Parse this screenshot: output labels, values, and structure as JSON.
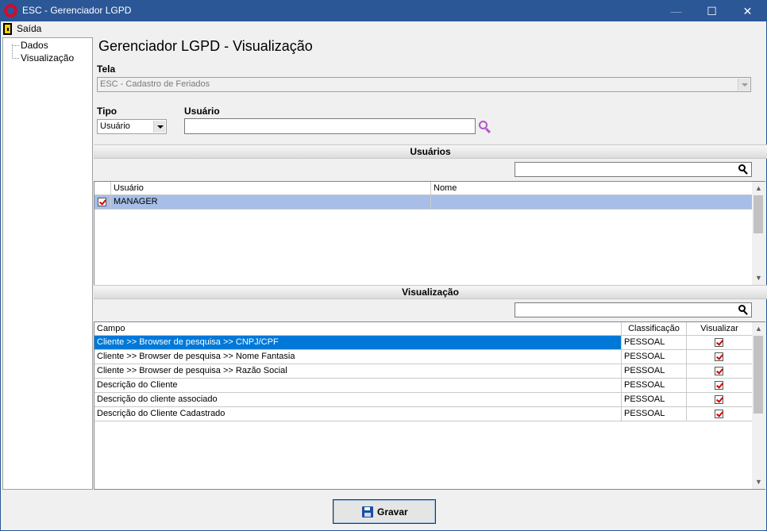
{
  "window": {
    "title": "ESC - Gerenciador LGPD",
    "minimize": "—",
    "maximize": "☐",
    "close": "✕"
  },
  "menu": {
    "saida": "Saída"
  },
  "nav": {
    "items": [
      {
        "label": "Dados"
      },
      {
        "label": "Visualização"
      }
    ]
  },
  "heading": "Gerenciador LGPD - Visualização",
  "tela": {
    "label": "Tela",
    "value": "ESC - Cadastro de Feriados"
  },
  "tipo": {
    "label": "Tipo",
    "value": "Usuário"
  },
  "usuario": {
    "label": "Usuário",
    "value": ""
  },
  "usuarios_section": {
    "title": "Usuários",
    "search_value": "",
    "columns": [
      "Usuário",
      "Nome"
    ],
    "rows": [
      {
        "checked": true,
        "usuario": "MANAGER",
        "nome": ""
      }
    ]
  },
  "visualizacao_section": {
    "title": "Visualização",
    "search_value": "",
    "columns": [
      "Campo",
      "Classificação",
      "Visualizar"
    ],
    "rows": [
      {
        "campo": "Cliente >> Browser de pesquisa >> CNPJ/CPF",
        "classificacao": "PESSOAL",
        "visualizar": true
      },
      {
        "campo": "Cliente >> Browser de pesquisa >> Nome Fantasia",
        "classificacao": "PESSOAL",
        "visualizar": true
      },
      {
        "campo": "Cliente >> Browser de pesquisa >> Razão Social",
        "classificacao": "PESSOAL",
        "visualizar": true
      },
      {
        "campo": "Descrição do Cliente",
        "classificacao": "PESSOAL",
        "visualizar": true
      },
      {
        "campo": "Descrição do cliente associado",
        "classificacao": "PESSOAL",
        "visualizar": true
      },
      {
        "campo": "Descrição do Cliente Cadastrado",
        "classificacao": "PESSOAL",
        "visualizar": true
      }
    ]
  },
  "buttons": {
    "gravar": "Gravar"
  },
  "colors": {
    "titlebar": "#2b5797",
    "selection": "#0078d7",
    "selection_light": "#a6bee8",
    "check": "#d40000"
  }
}
